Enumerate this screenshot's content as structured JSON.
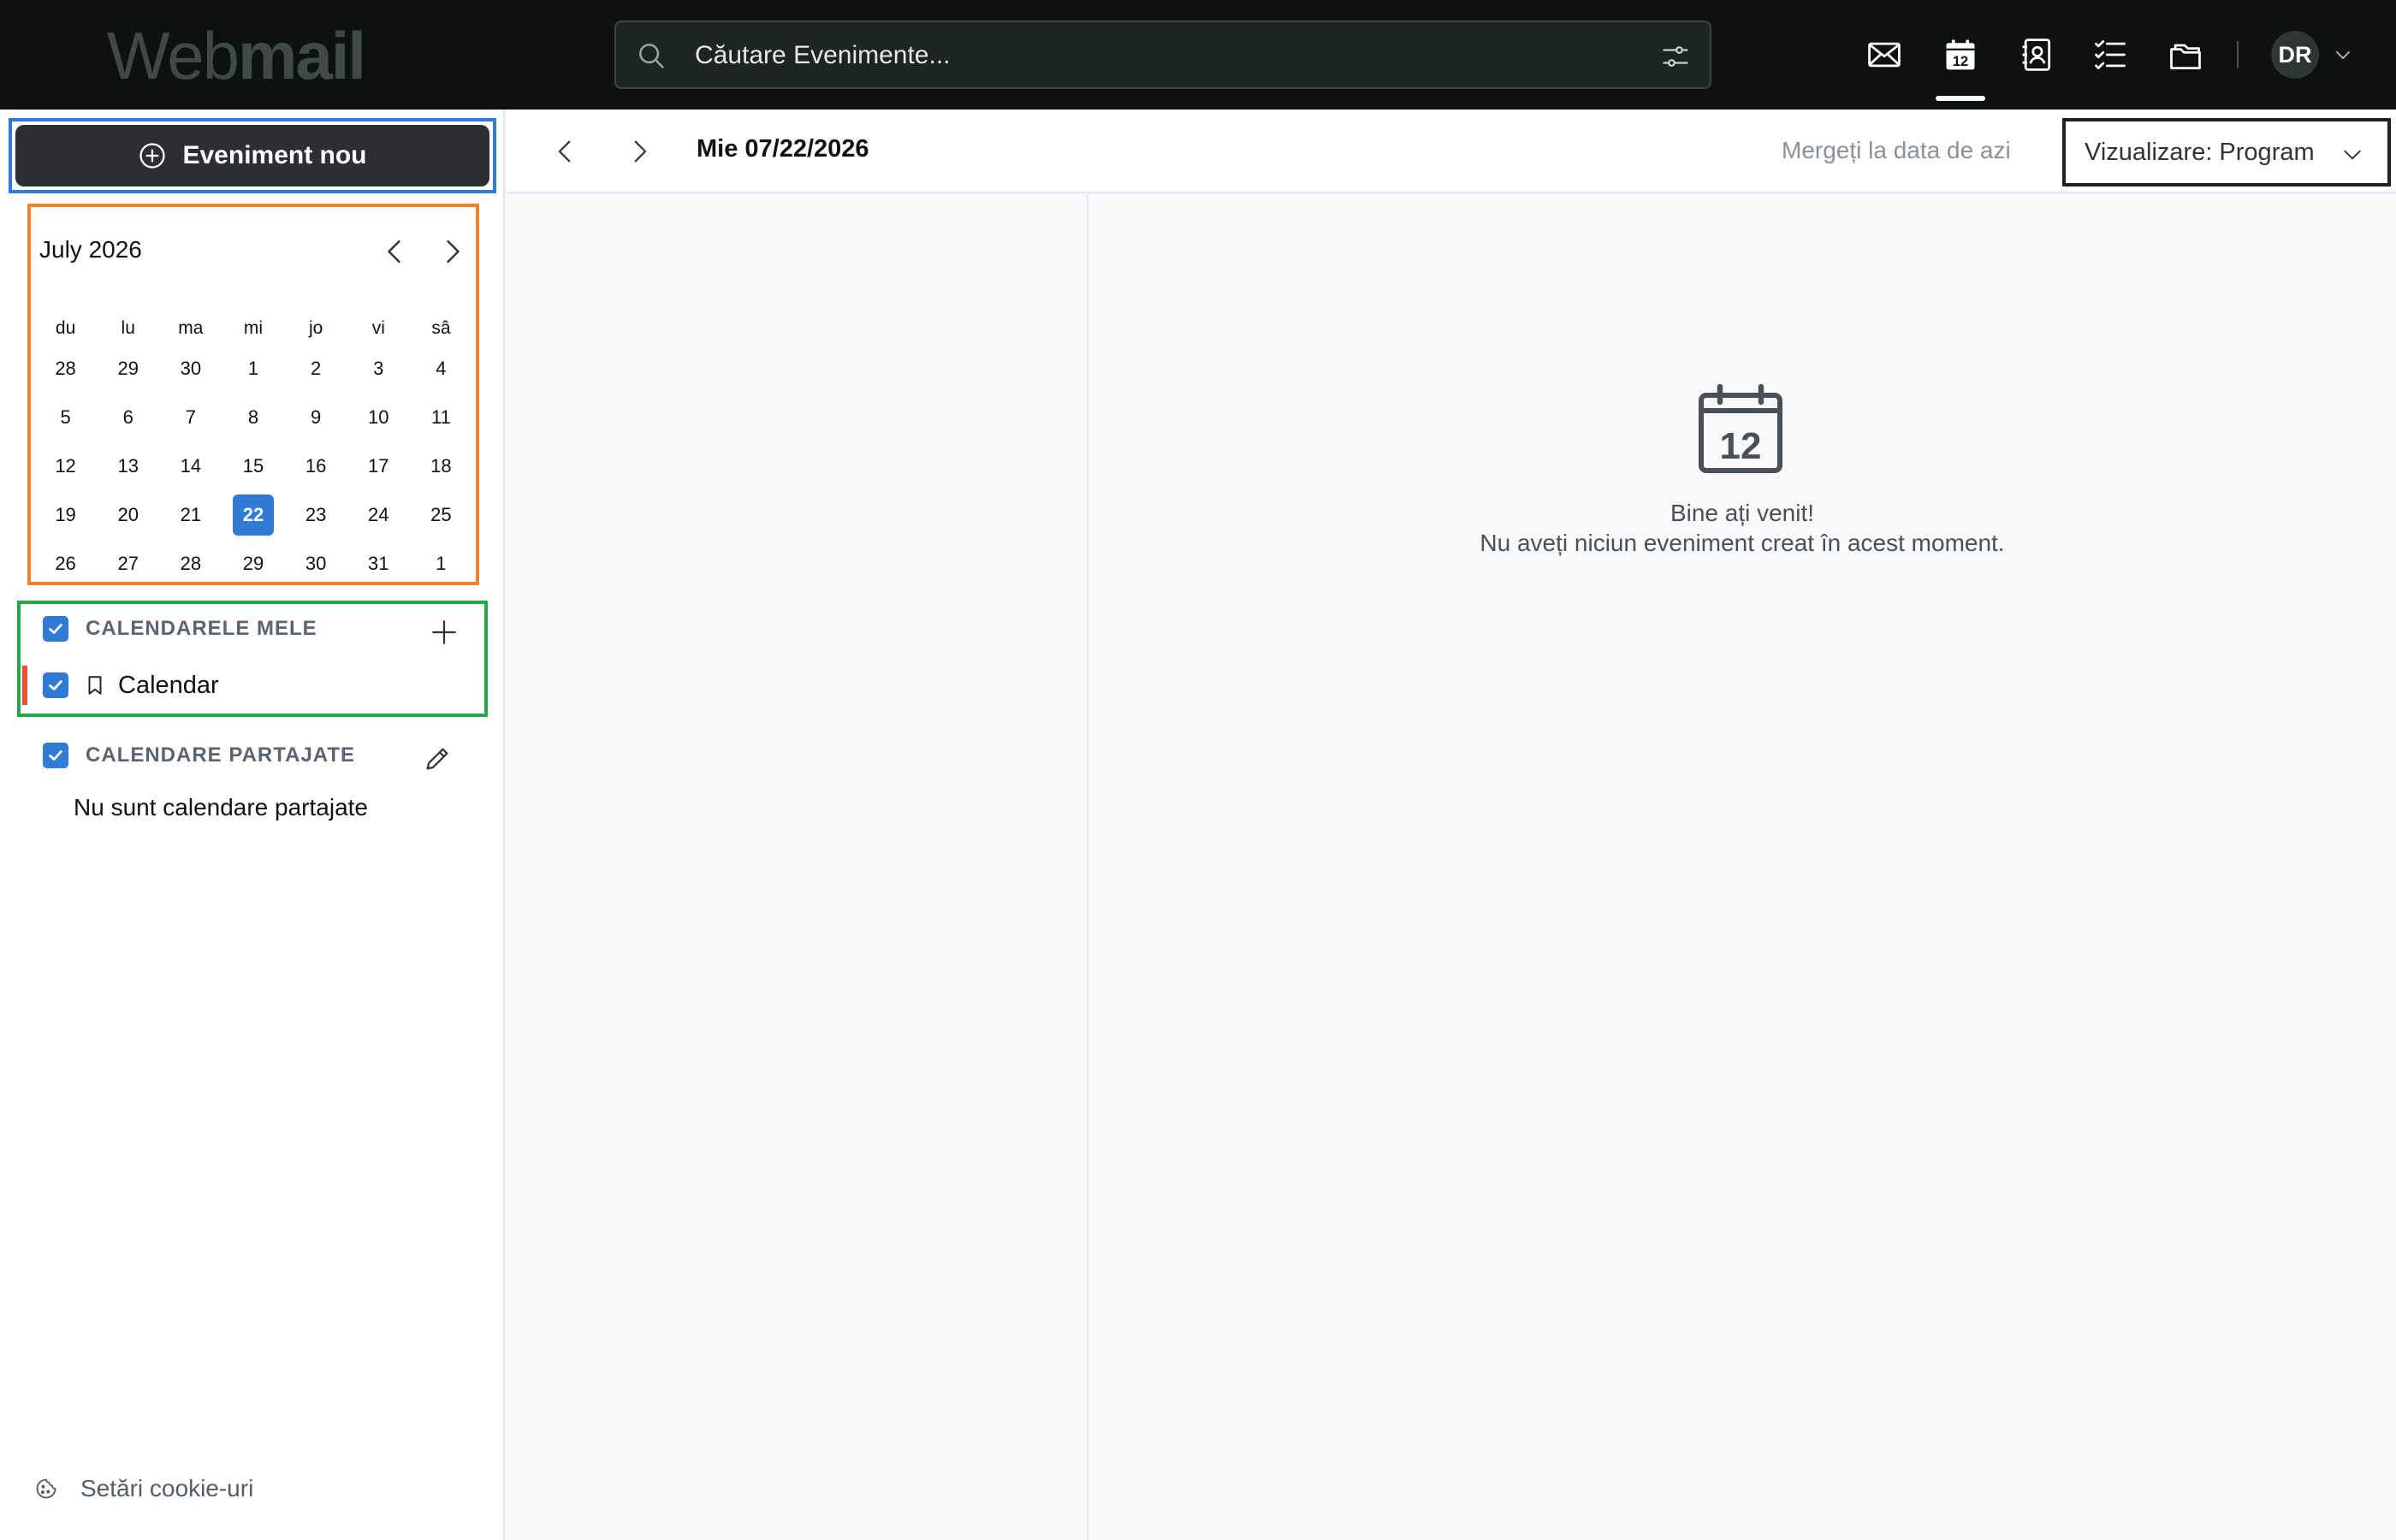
{
  "app": {
    "logo_light": "Web",
    "logo_bold": "mail"
  },
  "search": {
    "placeholder": "Căutare Evenimente..."
  },
  "nav_icons": [
    "mail-icon",
    "calendar-icon",
    "contacts-icon",
    "tasks-icon",
    "files-icon"
  ],
  "user": {
    "initials": "DR"
  },
  "sidebar": {
    "new_event_label": "Eveniment nou",
    "mini_calendar": {
      "month_label": "July 2026",
      "weekdays": [
        "du",
        "lu",
        "ma",
        "mi",
        "jo",
        "vi",
        "sâ"
      ],
      "weeks": [
        [
          "28",
          "29",
          "30",
          "1",
          "2",
          "3",
          "4"
        ],
        [
          "5",
          "6",
          "7",
          "8",
          "9",
          "10",
          "11"
        ],
        [
          "12",
          "13",
          "14",
          "15",
          "16",
          "17",
          "18"
        ],
        [
          "19",
          "20",
          "21",
          "22",
          "23",
          "24",
          "25"
        ],
        [
          "26",
          "27",
          "28",
          "29",
          "30",
          "31",
          "1"
        ]
      ],
      "selected_day": "22"
    },
    "my_calendars": {
      "title": "CALENDARELE MELE",
      "items": [
        {
          "label": "Calendar",
          "color": "#e8503a",
          "checked": true
        }
      ]
    },
    "shared_calendars": {
      "title": "CALENDARE PARTAJATE",
      "empty_text": "Nu sunt calendare partajate"
    },
    "cookie_settings": "Setări cookie-uri"
  },
  "toolbar": {
    "current_date": "Mie 07/22/2026",
    "go_today": "Mergeți la data de azi",
    "view_select": "Vizualizare: Program"
  },
  "main": {
    "welcome_title": "Bine ați venit!",
    "welcome_text": "Nu aveți niciun eveniment creat în acest moment."
  },
  "colors": {
    "accent": "#2f7bd6",
    "topbar": "#0b1210",
    "calendar_color": "#e8503a"
  }
}
